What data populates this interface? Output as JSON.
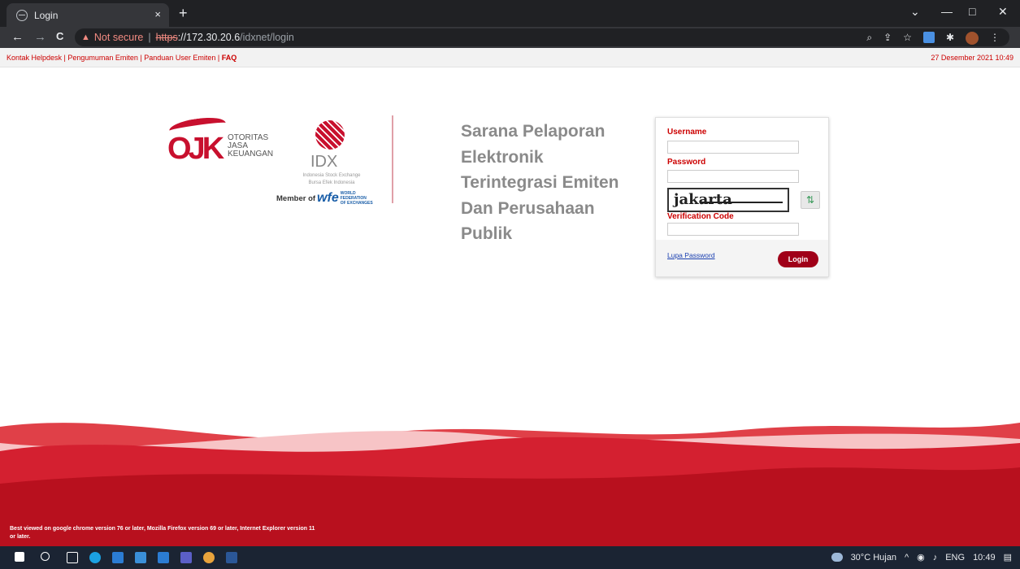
{
  "browser": {
    "tab_title": "Login",
    "tab_close": "×",
    "new_tab": "+",
    "back": "←",
    "forward": "→",
    "reload": "C",
    "not_secure": "Not secure",
    "separator": "|",
    "scheme": "https",
    "host": "://172.30.20.6",
    "path": "/idxnet/login",
    "minimize": "—",
    "maximize": "□",
    "close": "✕",
    "dropdown": "⌄"
  },
  "topbar": {
    "link_helpdesk": "Kontak Helpdesk",
    "link_announcement": "Pengumuman Emiten",
    "link_guide": "Panduan User Emiten",
    "link_faq": "FAQ",
    "divider": " | ",
    "datetime": "27 Desember 2021 10:49"
  },
  "logos": {
    "ojk_letters": "OJK",
    "ojk_line1": "OTORITAS",
    "ojk_line2": "JASA",
    "ojk_line3": "KEUANGAN",
    "idx": "IDX",
    "idx_sub1": "Indonesia Stock Exchange",
    "idx_sub2": "Bursa Efek Indonesia",
    "member_of": "Member of",
    "wfe_mark": "wfe",
    "wfe_line1": "WORLD FEDERATION",
    "wfe_line2": "OF EXCHANGES"
  },
  "headline": {
    "line1": "Sarana Pelaporan",
    "line2": "Elektronik",
    "line3": "Terintegrasi Emiten",
    "line4": "Dan Perusahaan",
    "line5": "Publik"
  },
  "login": {
    "username_label": "Username",
    "username_value": "",
    "password_label": "Password",
    "password_value": "",
    "captcha_text": "jakarta",
    "refresh_icon": "⇅",
    "verification_label": "Verification Code",
    "verification_value": "",
    "forgot_password": "Lupa Password",
    "login_button": "Login"
  },
  "footer": {
    "note": "Best viewed on google chrome version 76 or later, Mozilla Firefox version 69 or later, Internet Explorer version 11 or later."
  },
  "taskbar": {
    "weather": "30°C Hujan",
    "lang": "ENG",
    "time": "10:49"
  },
  "colors": {
    "brand_red": "#c8102e",
    "dark_red": "#a00018",
    "headline_gray": "#8a8a8a"
  }
}
